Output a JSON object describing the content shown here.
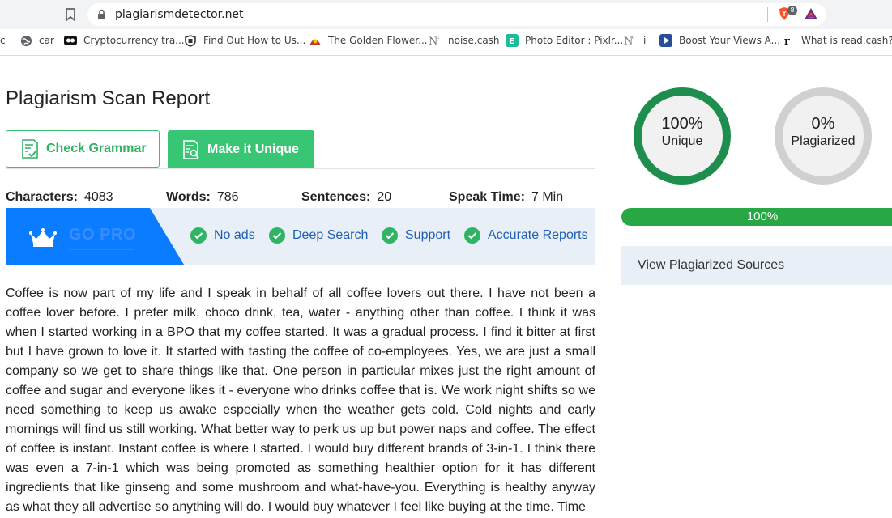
{
  "browser": {
    "url": "plagiarismdetector.net",
    "brave_badge": "8",
    "bookmarks": [
      {
        "label": "c",
        "icon": "partial-icon"
      },
      {
        "label": "car",
        "icon": "globe-icon"
      },
      {
        "label": "Cryptocurrency tra...",
        "icon": "crypto-icon"
      },
      {
        "label": "Find Out How to Us...",
        "icon": "shield-icon"
      },
      {
        "label": "The Golden Flower...",
        "icon": "flower-icon"
      },
      {
        "label": "noise.cash",
        "icon": "noise-icon"
      },
      {
        "label": "Photo Editor : Pixlr...",
        "icon": "pixlr-icon"
      },
      {
        "label": "i",
        "icon": "noise-icon"
      },
      {
        "label": "Boost Your Views A...",
        "icon": "play-icon"
      },
      {
        "label": "What is read.cash?...",
        "icon": "readcash-icon"
      }
    ]
  },
  "page": {
    "title": "Plagiarism Scan Report",
    "check_grammar": "Check Grammar",
    "make_unique": "Make it Unique",
    "stats": [
      {
        "label": "Characters:",
        "value": "4083"
      },
      {
        "label": "Words:",
        "value": "786"
      },
      {
        "label": "Sentences:",
        "value": "20"
      },
      {
        "label": "Speak Time:",
        "value": "7 Min"
      }
    ],
    "go_pro": "GO PRO",
    "features": [
      "No ads",
      "Deep Search",
      "Support",
      "Accurate Reports"
    ],
    "article": "Coffee is now part of my life and I speak in behalf of all coffee lovers out there. I have not been a coffee lover before. I prefer milk, choco drink, tea, water - anything other than coffee. I think it was when I started working in a BPO that my coffee started. It was a gradual process. I find it bitter at first but I have grown to love it. It started with tasting the coffee of co-employees. Yes, we are just a small company so we get to share things like that. One person in particular mixes just the right amount of coffee and sugar and everyone likes it - everyone who drinks coffee that is. We work night shifts so we need something to keep us awake especially when the weather gets cold. Cold nights and early mornings will find us still working. What better way to perk us up but power naps and coffee. The effect of coffee is instant. Instant coffee is where I started. I would buy different brands of 3-in-1. I think there was even a 7-in-1 which was being promoted as something healthier option for it has different ingredients that like ginseng and some mushroom and what-have-you. Everything is healthy anyway as what they all advertise so anything will do. I would buy whatever I feel like buying at the time. Time"
  },
  "results": {
    "unique_pct": "100%",
    "unique_label": "Unique",
    "plagiarized_pct": "0%",
    "plagiarized_label": "Plagiarized",
    "progress_label": "100%",
    "progress_fraction": 1.0,
    "view_sources": "View Plagiarized Sources"
  },
  "colors": {
    "green": "#1e8e4e",
    "accent_green": "#39c674",
    "blue": "#0a7cff",
    "ring_gray": "#d0d0d0",
    "progress": "#28a745"
  }
}
